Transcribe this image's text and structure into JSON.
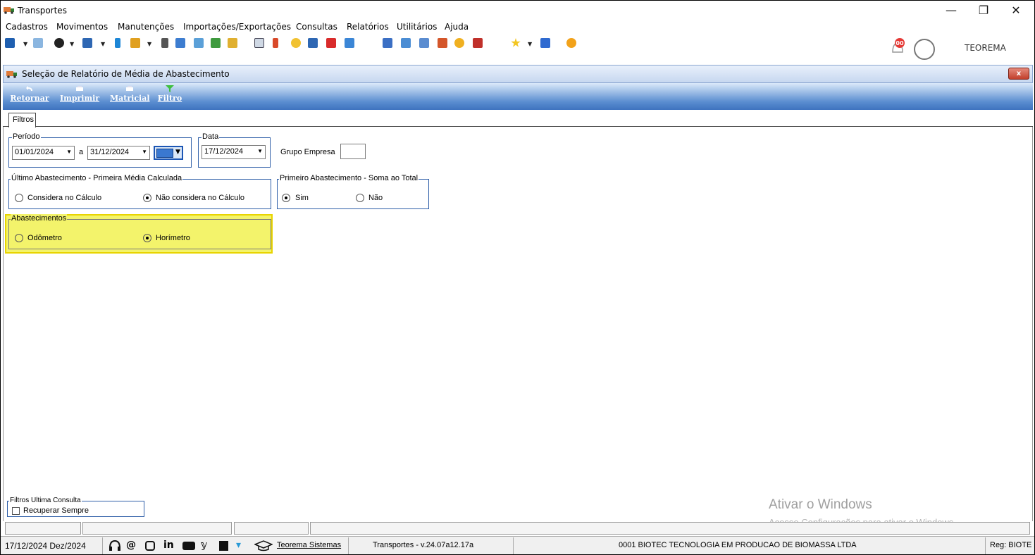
{
  "window": {
    "title": "Transportes",
    "minimize": "—",
    "restore": "❐",
    "close": "✕"
  },
  "menu": [
    "Cadastros",
    "Movimentos",
    "Manutenções",
    "Importações/Exportações",
    "Consultas",
    "Relatórios",
    "Utilitários",
    "Ajuda"
  ],
  "toolbar": {
    "notification_count": "00",
    "user": "TEOREMA"
  },
  "child_window": {
    "title": "Seleção de Relatório de Média de Abastecimento",
    "close": "x"
  },
  "actions": {
    "return": "Retornar",
    "print": "Imprimir",
    "matrix": "Matricial",
    "filter": "Filtro"
  },
  "tabs": {
    "filters": "Filtros"
  },
  "period": {
    "title": "Período",
    "start": "01/01/2024",
    "separator": "a",
    "end": "31/12/2024"
  },
  "date": {
    "title": "Data",
    "value": "17/12/2024"
  },
  "group_company": {
    "label": "Grupo Empresa",
    "value": ""
  },
  "last_refuel": {
    "title": "Último Abastecimento - Primeira Média Calculada",
    "options": [
      "Considera no Cálculo",
      "Não considera no Cálculo"
    ],
    "selected": 1
  },
  "first_refuel": {
    "title": "Primeiro Abastecimento - Soma ao Total",
    "options": [
      "Sim",
      "Não"
    ],
    "selected": 0
  },
  "refuels": {
    "title": "Abastecimentos",
    "options": [
      "Odômetro",
      "Horímetro"
    ],
    "selected": 1,
    "highlight_color": "#f3f36b"
  },
  "last_query": {
    "title": "Filtros Ultima Consulta",
    "checkbox_label": "Recuperar Sempre",
    "checked": false
  },
  "watermark": {
    "line1": "Ativar o Windows",
    "line2": "Acesse Configurações para ativar o Windows."
  },
  "status": {
    "date": "17/12/2024 Dez/2024",
    "company_link": "Teorema Sistemas",
    "version": "Transportes - v.24.07a12.17a",
    "company": "0001 BIOTEC TECNOLOGIA EM PRODUCAO DE BIOMASSA LTDA",
    "reg": "Reg: BIOTE"
  }
}
